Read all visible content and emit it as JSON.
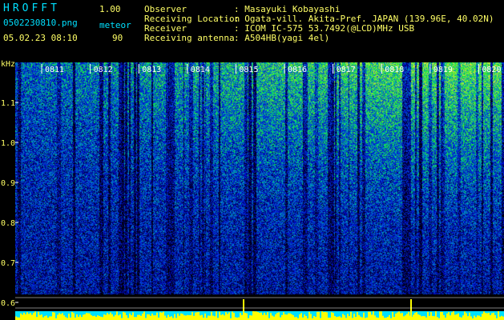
{
  "app": {
    "name": "HROFFT",
    "version": "1.00"
  },
  "file": {
    "name": "0502230810.png",
    "datetime": "05.02.23 08:10"
  },
  "mode": {
    "label": "meteor",
    "value": "90"
  },
  "info": [
    {
      "key": "Observer",
      "value": ": Masayuki Kobayashi"
    },
    {
      "key": "Receiving Location",
      "value": ": Ogata-vill. Akita-Pref. JAPAN (139.96E, 40.02N)"
    },
    {
      "key": "Receiver",
      "value": ": ICOM IC-575 53.7492(@LCD)MHz USB"
    },
    {
      "key": "Receiving antenna",
      "value": ": A504HB(yagi 4el)"
    }
  ],
  "axis": {
    "unit": "kHz",
    "y_ticks": [
      "1.1",
      "1.0",
      "0.9",
      "0.8",
      "0.7",
      "0.6"
    ],
    "time_ticks": [
      "0811",
      "0812",
      "0813",
      "0814",
      "0815",
      "0816",
      "0817",
      "0818",
      "0819",
      "0820"
    ]
  },
  "colors": {
    "label": "#ffff66",
    "logo": "#00e0ff",
    "grid": "#ffffff",
    "bar": "#ffff00",
    "bar_base": "#00e0ff"
  }
}
